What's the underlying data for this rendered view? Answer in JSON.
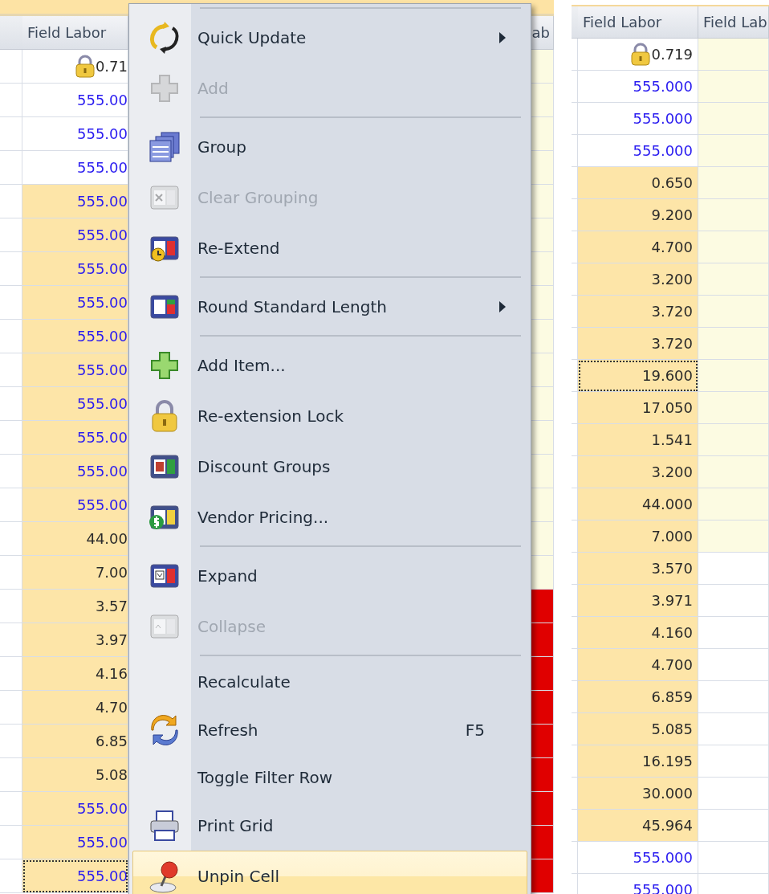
{
  "left_grid": {
    "columns": [
      {
        "label": "Field Labor"
      },
      {
        "label": "ab"
      }
    ],
    "rows": [
      {
        "value": "0.71",
        "locked": true,
        "kind": "custom",
        "highlighted": false,
        "flagged": false,
        "selected": false
      },
      {
        "value": "555.00",
        "locked": false,
        "kind": "default",
        "highlighted": false,
        "flagged": false,
        "selected": false
      },
      {
        "value": "555.00",
        "locked": false,
        "kind": "default",
        "highlighted": false,
        "flagged": false,
        "selected": false
      },
      {
        "value": "555.00",
        "locked": false,
        "kind": "default",
        "highlighted": false,
        "flagged": false,
        "selected": false
      },
      {
        "value": "555.00",
        "locked": false,
        "kind": "default",
        "highlighted": true,
        "flagged": false,
        "selected": false
      },
      {
        "value": "555.00",
        "locked": false,
        "kind": "default",
        "highlighted": true,
        "flagged": false,
        "selected": false
      },
      {
        "value": "555.00",
        "locked": false,
        "kind": "default",
        "highlighted": true,
        "flagged": false,
        "selected": false
      },
      {
        "value": "555.00",
        "locked": false,
        "kind": "default",
        "highlighted": true,
        "flagged": false,
        "selected": false
      },
      {
        "value": "555.00",
        "locked": false,
        "kind": "default",
        "highlighted": true,
        "flagged": false,
        "selected": false
      },
      {
        "value": "555.00",
        "locked": false,
        "kind": "default",
        "highlighted": true,
        "flagged": false,
        "selected": false
      },
      {
        "value": "555.00",
        "locked": false,
        "kind": "default",
        "highlighted": true,
        "flagged": false,
        "selected": false
      },
      {
        "value": "555.00",
        "locked": false,
        "kind": "default",
        "highlighted": true,
        "flagged": false,
        "selected": false
      },
      {
        "value": "555.00",
        "locked": false,
        "kind": "default",
        "highlighted": true,
        "flagged": false,
        "selected": false
      },
      {
        "value": "555.00",
        "locked": false,
        "kind": "default",
        "highlighted": true,
        "flagged": false,
        "selected": false
      },
      {
        "value": "44.00",
        "locked": false,
        "kind": "custom",
        "highlighted": true,
        "flagged": false,
        "selected": false
      },
      {
        "value": "7.00",
        "locked": false,
        "kind": "custom",
        "highlighted": true,
        "flagged": false,
        "selected": false
      },
      {
        "value": "3.57",
        "locked": false,
        "kind": "custom",
        "highlighted": true,
        "flagged": true,
        "selected": false
      },
      {
        "value": "3.97",
        "locked": false,
        "kind": "custom",
        "highlighted": true,
        "flagged": true,
        "selected": false
      },
      {
        "value": "4.16",
        "locked": false,
        "kind": "custom",
        "highlighted": true,
        "flagged": true,
        "selected": false
      },
      {
        "value": "4.70",
        "locked": false,
        "kind": "custom",
        "highlighted": true,
        "flagged": true,
        "selected": false
      },
      {
        "value": "6.85",
        "locked": false,
        "kind": "custom",
        "highlighted": true,
        "flagged": true,
        "selected": false
      },
      {
        "value": "5.08",
        "locked": false,
        "kind": "custom",
        "highlighted": true,
        "flagged": true,
        "selected": false
      },
      {
        "value": "555.00",
        "locked": false,
        "kind": "default",
        "highlighted": true,
        "flagged": true,
        "selected": false
      },
      {
        "value": "555.00",
        "locked": false,
        "kind": "default",
        "highlighted": true,
        "flagged": true,
        "selected": false
      },
      {
        "value": "555.00",
        "locked": false,
        "kind": "default",
        "highlighted": true,
        "flagged": true,
        "selected": true
      }
    ]
  },
  "context_menu": {
    "items": [
      {
        "kind": "separator"
      },
      {
        "kind": "item",
        "label": "Quick Update",
        "disabled": false,
        "submenu": true,
        "selected": false
      },
      {
        "kind": "item",
        "label": "Add",
        "disabled": true,
        "submenu": false,
        "selected": false
      },
      {
        "kind": "separator"
      },
      {
        "kind": "item",
        "label": "Group",
        "disabled": false,
        "submenu": false,
        "selected": false
      },
      {
        "kind": "item",
        "label": "Clear Grouping",
        "disabled": true,
        "submenu": false,
        "selected": false
      },
      {
        "kind": "item",
        "label": "Re-Extend",
        "disabled": false,
        "submenu": false,
        "selected": false
      },
      {
        "kind": "separator"
      },
      {
        "kind": "item",
        "label": "Round Standard Length",
        "disabled": false,
        "submenu": true,
        "selected": false
      },
      {
        "kind": "separator"
      },
      {
        "kind": "item",
        "label": "Add Item...",
        "disabled": false,
        "submenu": false,
        "selected": false
      },
      {
        "kind": "item",
        "label": "Re-extension Lock",
        "disabled": false,
        "submenu": false,
        "selected": false
      },
      {
        "kind": "item",
        "label": "Discount Groups",
        "disabled": false,
        "submenu": false,
        "selected": false
      },
      {
        "kind": "item",
        "label": "Vendor Pricing...",
        "disabled": false,
        "submenu": false,
        "selected": false
      },
      {
        "kind": "separator"
      },
      {
        "kind": "item",
        "label": "Expand",
        "disabled": false,
        "submenu": false,
        "selected": false
      },
      {
        "kind": "item",
        "label": "Collapse",
        "disabled": true,
        "submenu": false,
        "selected": false
      },
      {
        "kind": "separator"
      },
      {
        "kind": "item",
        "label": "Recalculate",
        "disabled": false,
        "submenu": false,
        "selected": false
      },
      {
        "kind": "item",
        "label": "Refresh",
        "shortcut": "F5",
        "disabled": false,
        "submenu": false,
        "selected": false
      },
      {
        "kind": "item",
        "label": "Toggle Filter Row",
        "disabled": false,
        "submenu": false,
        "selected": false
      },
      {
        "kind": "item",
        "label": "Print Grid",
        "disabled": false,
        "submenu": false,
        "selected": false
      },
      {
        "kind": "item",
        "label": "Unpin Cell",
        "disabled": false,
        "submenu": false,
        "selected": true
      }
    ]
  },
  "right_grid": {
    "columns": [
      {
        "label": "Field Labor"
      },
      {
        "label": "Field Lab"
      }
    ],
    "rows": [
      {
        "value": "0.719",
        "locked": true,
        "kind": "custom",
        "highlighted": false,
        "shaded": true,
        "selected": false
      },
      {
        "value": "555.000",
        "locked": false,
        "kind": "default",
        "highlighted": false,
        "shaded": true,
        "selected": false
      },
      {
        "value": "555.000",
        "locked": false,
        "kind": "default",
        "highlighted": false,
        "shaded": true,
        "selected": false
      },
      {
        "value": "555.000",
        "locked": false,
        "kind": "default",
        "highlighted": false,
        "shaded": true,
        "selected": false
      },
      {
        "value": "0.650",
        "locked": false,
        "kind": "custom",
        "highlighted": true,
        "shaded": true,
        "selected": false
      },
      {
        "value": "9.200",
        "locked": false,
        "kind": "custom",
        "highlighted": true,
        "shaded": true,
        "selected": false
      },
      {
        "value": "4.700",
        "locked": false,
        "kind": "custom",
        "highlighted": true,
        "shaded": true,
        "selected": false
      },
      {
        "value": "3.200",
        "locked": false,
        "kind": "custom",
        "highlighted": true,
        "shaded": true,
        "selected": false
      },
      {
        "value": "3.720",
        "locked": false,
        "kind": "custom",
        "highlighted": true,
        "shaded": true,
        "selected": false
      },
      {
        "value": "3.720",
        "locked": false,
        "kind": "custom",
        "highlighted": true,
        "shaded": true,
        "selected": false
      },
      {
        "value": "19.600",
        "locked": false,
        "kind": "custom",
        "highlighted": true,
        "shaded": true,
        "selected": true
      },
      {
        "value": "17.050",
        "locked": false,
        "kind": "custom",
        "highlighted": true,
        "shaded": true,
        "selected": false
      },
      {
        "value": "1.541",
        "locked": false,
        "kind": "custom",
        "highlighted": true,
        "shaded": true,
        "selected": false
      },
      {
        "value": "3.200",
        "locked": false,
        "kind": "custom",
        "highlighted": true,
        "shaded": true,
        "selected": false
      },
      {
        "value": "44.000",
        "locked": false,
        "kind": "custom",
        "highlighted": true,
        "shaded": true,
        "selected": false
      },
      {
        "value": "7.000",
        "locked": false,
        "kind": "custom",
        "highlighted": true,
        "shaded": true,
        "selected": false
      },
      {
        "value": "3.570",
        "locked": false,
        "kind": "custom",
        "highlighted": true,
        "shaded": false,
        "selected": false
      },
      {
        "value": "3.971",
        "locked": false,
        "kind": "custom",
        "highlighted": true,
        "shaded": false,
        "selected": false
      },
      {
        "value": "4.160",
        "locked": false,
        "kind": "custom",
        "highlighted": true,
        "shaded": false,
        "selected": false
      },
      {
        "value": "4.700",
        "locked": false,
        "kind": "custom",
        "highlighted": true,
        "shaded": false,
        "selected": false
      },
      {
        "value": "6.859",
        "locked": false,
        "kind": "custom",
        "highlighted": true,
        "shaded": false,
        "selected": false
      },
      {
        "value": "5.085",
        "locked": false,
        "kind": "custom",
        "highlighted": true,
        "shaded": false,
        "selected": false
      },
      {
        "value": "16.195",
        "locked": false,
        "kind": "custom",
        "highlighted": true,
        "shaded": false,
        "selected": false
      },
      {
        "value": "30.000",
        "locked": false,
        "kind": "custom",
        "highlighted": true,
        "shaded": false,
        "selected": false
      },
      {
        "value": "45.964",
        "locked": false,
        "kind": "custom",
        "highlighted": true,
        "shaded": false,
        "selected": false
      },
      {
        "value": "555.000",
        "locked": false,
        "kind": "default",
        "highlighted": false,
        "shaded": false,
        "selected": false
      },
      {
        "value": "555.000",
        "locked": false,
        "kind": "default",
        "highlighted": false,
        "shaded": false,
        "selected": false
      }
    ]
  }
}
